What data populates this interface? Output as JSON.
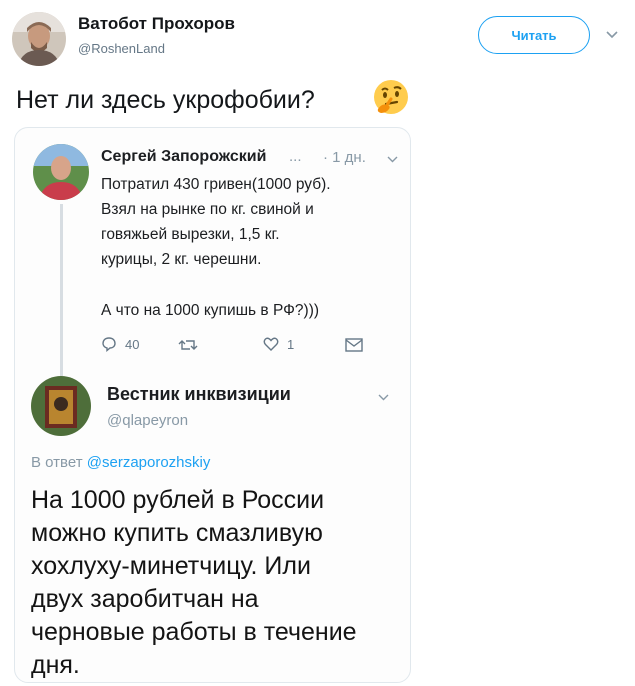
{
  "header": {
    "name": "Ватобот Прохоров",
    "handle": "@RoshenLand",
    "follow_label": "Читать"
  },
  "tweet": {
    "text": "Нет ли здесь укрофобии?",
    "emoji": "thinking-face-icon"
  },
  "quoted": {
    "reply_tweet": {
      "name": "Сергей Запорожский",
      "ellipsis": "...",
      "time": "· 1 дн.",
      "lines": [
        "Потратил 430 гривен(1000 руб).",
        "Взял на рынке по кг. свиной и",
        "говяжьей вырезки, 1,5 кг.",
        "курицы, 2 кг. черешни."
      ],
      "question": "А что на 1000 купишь в РФ?)))",
      "reply_count": "40",
      "like_count": "1"
    },
    "answer_tweet": {
      "name": "Вестник инквизиции",
      "handle": "@qlapeyron",
      "reply_prefix": "В ответ",
      "reply_to": "@serzaporozhskiy",
      "lines": [
        "На 1000 рублей в России",
        "можно купить смазливую",
        "хохлуху-минетчицу. Или",
        "двух заробитчан на",
        "черновые работы в течение",
        "дня."
      ]
    }
  },
  "colors": {
    "accent": "#1da1f2",
    "muted": "#657786",
    "border": "#e1e8ed"
  }
}
